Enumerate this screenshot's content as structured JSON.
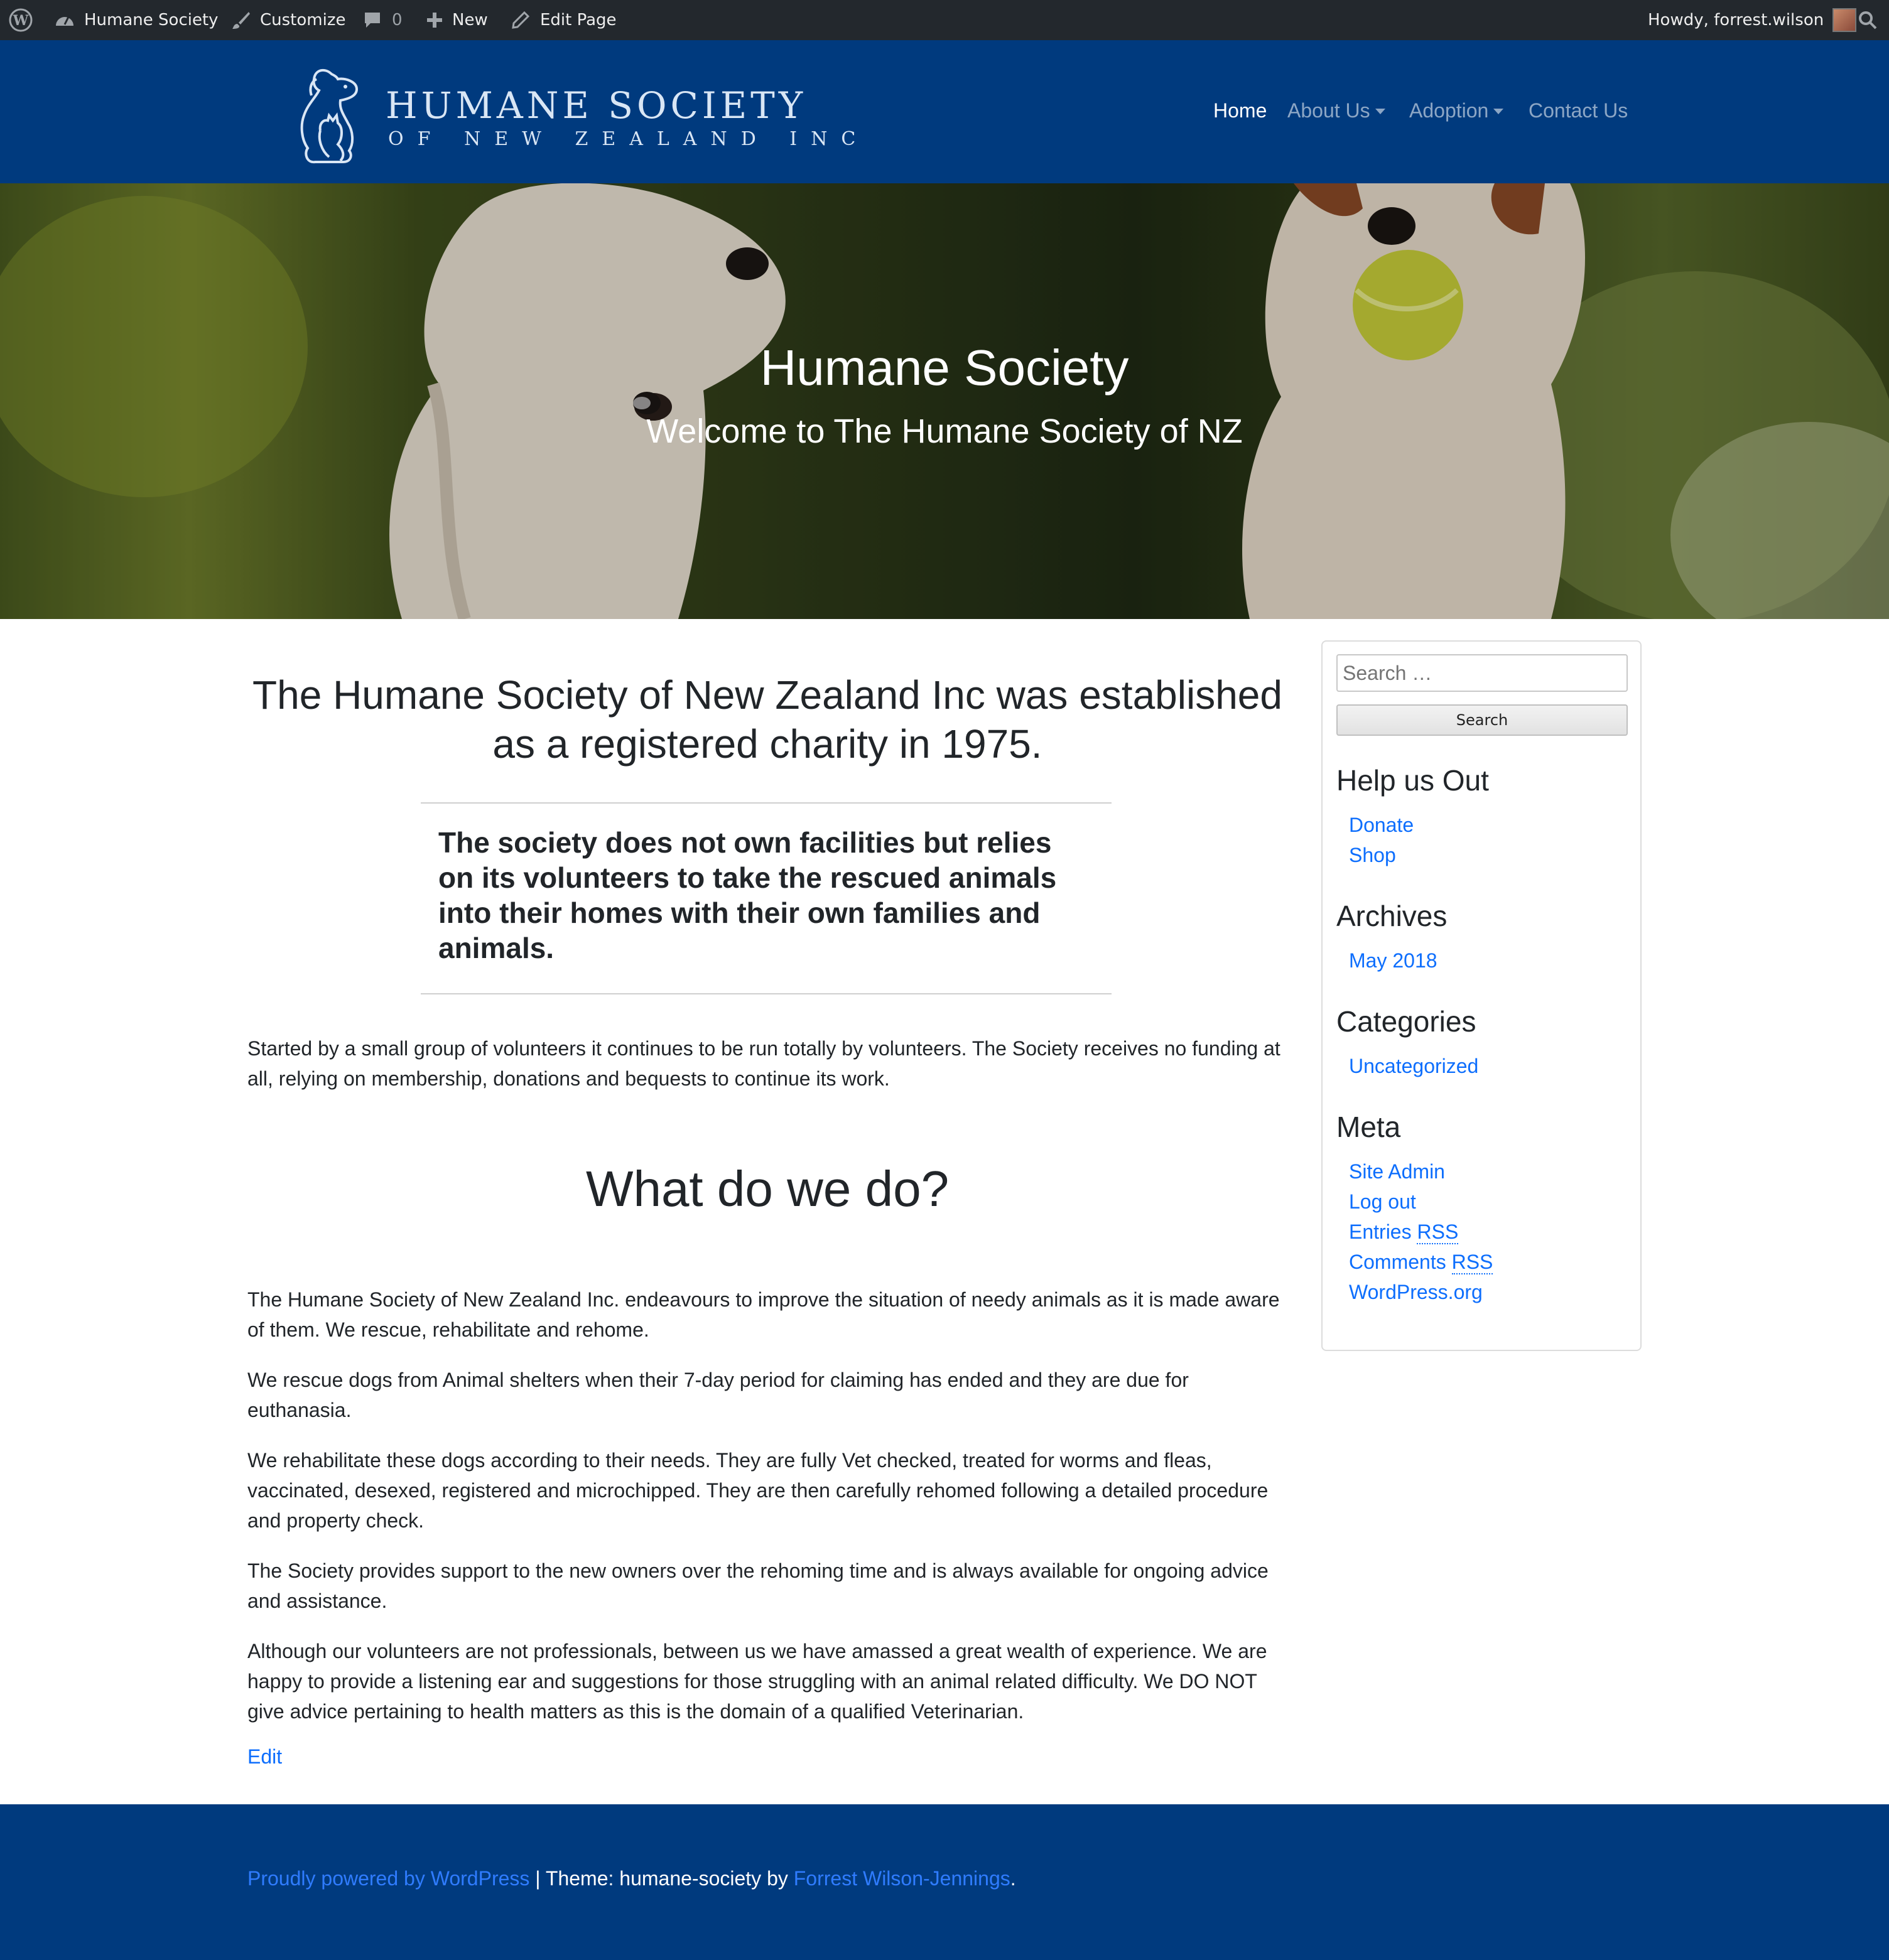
{
  "admin_bar": {
    "site_name": "Humane Society",
    "customize": "Customize",
    "comments_count": "0",
    "new_label": "New",
    "edit_page": "Edit Page",
    "greeting": "Howdy, forrest.wilson"
  },
  "header": {
    "logo_title": "HUMANE SOCIETY",
    "logo_subtitle": "OF NEW ZEALAND INC",
    "nav": [
      {
        "label": "Home",
        "active": true
      },
      {
        "label": "About Us",
        "dropdown": true
      },
      {
        "label": "Adoption",
        "dropdown": true
      },
      {
        "label": "Contact Us"
      }
    ]
  },
  "hero": {
    "title": "Humane Society",
    "subtitle": "Welcome to The Humane Society of NZ"
  },
  "content": {
    "lead": "The Humane Society of New Zealand Inc was established as a registered charity in 1975.",
    "quote": "The society does not own facilities but relies on its volunteers to take the rescued animals into their homes with their own families and animals.",
    "intro": "Started by a small group of volunteers it continues to be run totally by volunteers. The Society receives no funding at all, relying on membership, donations and bequests to continue its work.",
    "heading": "What do we do?",
    "paragraphs": [
      "The Humane Society of New Zealand Inc. endeavours to improve the situation of needy animals as it is made aware of them. We rescue, rehabilitate and rehome.",
      "We rescue dogs from Animal shelters when their 7-day period for claiming has ended and they are due for euthanasia.",
      "We rehabilitate these dogs according to their needs. They are fully Vet checked, treated for worms and fleas, vaccinated, desexed, registered and microchipped. They are then carefully rehomed following a detailed procedure and property check.",
      "The Society provides support to the new owners over the rehoming time and is always available for ongoing advice and assistance.",
      "Although our volunteers are not professionals, between us we have amassed a great wealth of experience. We are happy to provide a listening ear and suggestions for those struggling with an animal related difficulty. We DO NOT give advice pertaining to health matters as this is the domain of a qualified Veterinarian."
    ],
    "edit": "Edit"
  },
  "sidebar": {
    "search_placeholder": "Search …",
    "search_button": "Search",
    "help_title": "Help us Out",
    "help_links": [
      "Donate",
      "Shop"
    ],
    "archives_title": "Archives",
    "archives": [
      "May 2018"
    ],
    "categories_title": "Categories",
    "categories": [
      "Uncategorized"
    ],
    "meta_title": "Meta",
    "meta": {
      "site_admin": "Site Admin",
      "log_out": "Log out",
      "entries": "Entries",
      "comments": "Comments",
      "rss": "RSS",
      "wordpress": "WordPress.org"
    }
  },
  "footer": {
    "powered": "Proudly powered by WordPress",
    "separator": " | ",
    "theme_text": "Theme: humane-society by ",
    "author": "Forrest Wilson-Jennings",
    "period": "."
  },
  "colors": {
    "admin_bar": "#23282d",
    "brand_blue": "#003a7e",
    "link": "#0d6efd",
    "footer_link": "#2f7cff"
  }
}
